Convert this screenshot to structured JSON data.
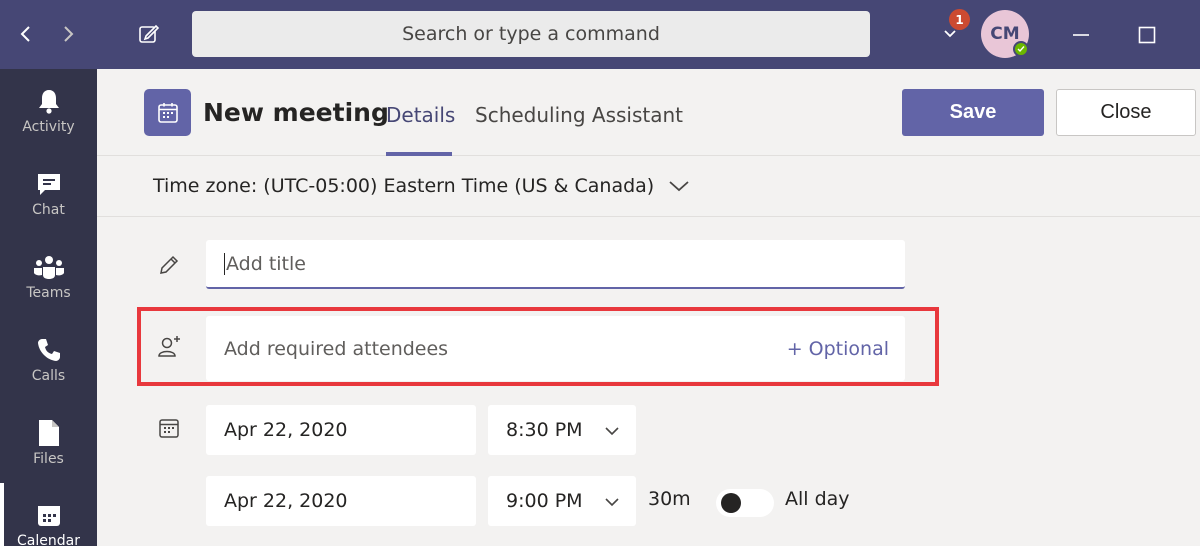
{
  "topbar": {
    "search_placeholder": "Search or type a command",
    "notification_count": "1",
    "avatar_initials": "CM"
  },
  "rail": {
    "items": [
      {
        "label": "Activity",
        "icon": "bell-icon"
      },
      {
        "label": "Chat",
        "icon": "chat-icon"
      },
      {
        "label": "Teams",
        "icon": "teams-icon"
      },
      {
        "label": "Calls",
        "icon": "phone-icon"
      },
      {
        "label": "Files",
        "icon": "file-icon"
      },
      {
        "label": "Calendar",
        "icon": "calendar-icon",
        "active": true
      }
    ]
  },
  "header": {
    "title": "New meeting",
    "tabs": [
      {
        "label": "Details",
        "active": true
      },
      {
        "label": "Scheduling Assistant",
        "active": false
      }
    ],
    "save_label": "Save",
    "close_label": "Close"
  },
  "timezone": {
    "label": "Time zone: (UTC-05:00) Eastern Time (US & Canada)"
  },
  "form": {
    "title_placeholder": "Add title",
    "attendees_placeholder": "Add required attendees",
    "optional_label": "+ Optional",
    "start_date": "Apr 22, 2020",
    "start_time": "8:30 PM",
    "end_date": "Apr 22, 2020",
    "end_time": "9:00 PM",
    "duration": "30m",
    "all_day_label": "All day",
    "all_day_on": false
  },
  "colors": {
    "brand": "#6264a7",
    "topbar": "#464775",
    "rail": "#33344a",
    "highlight": "#e8383d"
  }
}
